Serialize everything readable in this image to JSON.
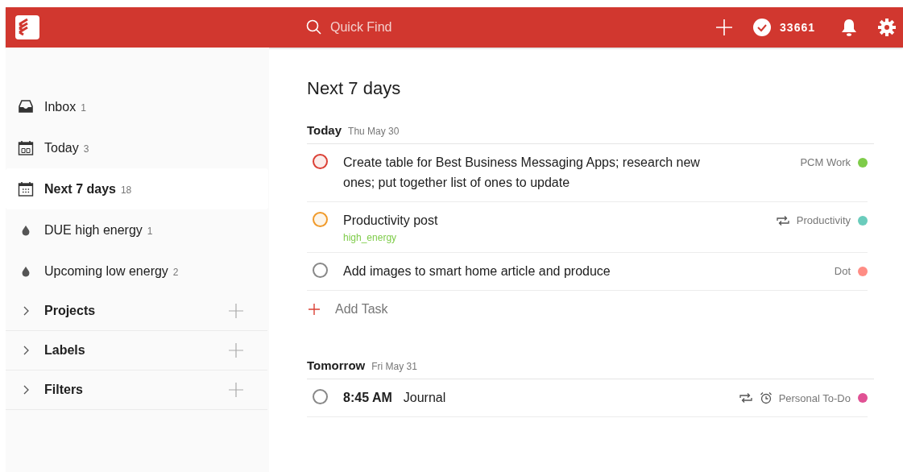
{
  "header": {
    "search_placeholder": "Quick Find",
    "karma": "33661"
  },
  "sidebar": {
    "items": [
      {
        "kind": "inbox",
        "label": "Inbox",
        "count": "1",
        "selected": false
      },
      {
        "kind": "today",
        "label": "Today",
        "count": "3",
        "selected": false
      },
      {
        "kind": "week",
        "label": "Next 7 days",
        "count": "18",
        "selected": true
      },
      {
        "kind": "filter",
        "label": "DUE high energy",
        "count": "1",
        "selected": false
      },
      {
        "kind": "filter",
        "label": "Upcoming low energy",
        "count": "2",
        "selected": false
      }
    ],
    "sections": [
      {
        "label": "Projects",
        "expanded": false
      },
      {
        "label": "Labels",
        "expanded": false
      },
      {
        "label": "Filters",
        "expanded": false
      }
    ]
  },
  "main": {
    "title": "Next 7 days",
    "days": [
      {
        "name": "Today",
        "date": "Thu May 30",
        "add_task": "Add Task",
        "tasks": [
          {
            "checkbox": {
              "color": "#db4035"
            },
            "text": "Create table for Best Business Messaging Apps; research new ones; put together list of ones to update",
            "project": "PCM Work",
            "color": "#7ecc49",
            "recurring": false,
            "reminder": false
          },
          {
            "checkbox": {
              "color": "#f09a2a"
            },
            "text": "Productivity post",
            "label": "high_energy",
            "project": "Productivity",
            "color": "#6accbc",
            "recurring": true,
            "reminder": false
          },
          {
            "checkbox": {
              "color": "#888888"
            },
            "text": "Add images to smart home article and produce",
            "project": "Dot",
            "color": "#ff8d85",
            "recurring": false,
            "reminder": false
          }
        ]
      },
      {
        "name": "Tomorrow",
        "date": "Fri May 31",
        "tasks": [
          {
            "checkbox": {
              "color": "#888888"
            },
            "time": "8:45 AM",
            "text": "Journal",
            "project": "Personal To-Do",
            "color": "#e05194",
            "recurring": true,
            "reminder": true
          }
        ]
      }
    ]
  }
}
